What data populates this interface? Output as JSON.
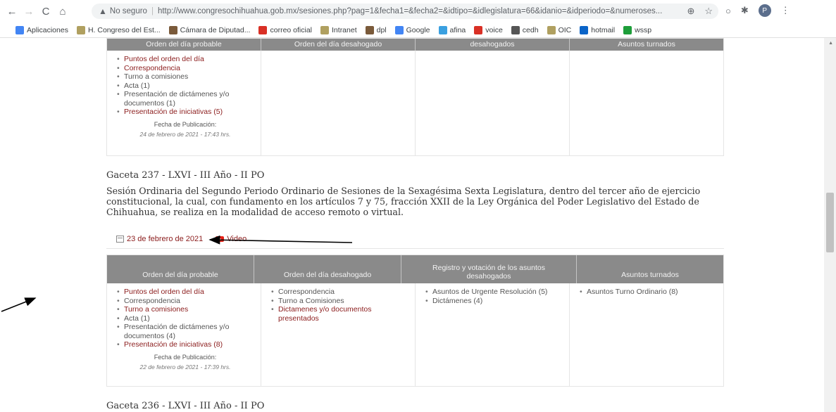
{
  "browser": {
    "not_secure": "No seguro",
    "url": "http://www.congresochihuahua.gob.mx/sesiones.php?pag=1&fecha1=&fecha2=&idtipo=&idlegislatura=66&idanio=&idperiodo=&numeroses...",
    "profile_initial": "P"
  },
  "bookmarks": [
    {
      "label": "Aplicaciones",
      "color": "#4285f4",
      "icon": "apps-grid-icon"
    },
    {
      "label": "H. Congreso del Est...",
      "color": "#b0a060",
      "icon": "congress-icon"
    },
    {
      "label": "Cámara de Diputad...",
      "color": "#7a5a3a",
      "icon": "camara-icon"
    },
    {
      "label": "correo oficial",
      "color": "#d93025",
      "icon": "x-icon"
    },
    {
      "label": "Intranet",
      "color": "#b0a060",
      "icon": "intranet-icon"
    },
    {
      "label": "dpl",
      "color": "#7a5a3a",
      "icon": "dpl-icon"
    },
    {
      "label": "Google",
      "color": "#4285f4",
      "icon": "google-icon"
    },
    {
      "label": "afina",
      "color": "#3aa0e0",
      "icon": "afina-icon"
    },
    {
      "label": "voice",
      "color": "#d93025",
      "icon": "voice-icon"
    },
    {
      "label": "cedh",
      "color": "#555555",
      "icon": "cedh-icon"
    },
    {
      "label": "OIC",
      "color": "#b0a060",
      "icon": "oic-icon"
    },
    {
      "label": "hotmail",
      "color": "#0a64c8",
      "icon": "outlook-icon"
    },
    {
      "label": "wssp",
      "color": "#1e9e3a",
      "icon": "wssp-icon"
    }
  ],
  "table_headers": [
    "Orden del día probable",
    "Orden del día desahogado",
    "Registro y votación de los asuntos desahogados",
    "Asuntos turnados"
  ],
  "table_headers_top": [
    "Orden del día probable",
    "Orden del día desahogado",
    "desahogados",
    "Asuntos turnados"
  ],
  "top_block": {
    "col1": [
      {
        "text": "Puntos del orden del día",
        "link": true
      },
      {
        "text": "Correspondencia",
        "link": true
      },
      {
        "text": "Turno a comisiones",
        "link": false
      },
      {
        "text": "Acta (1)",
        "link": false
      },
      {
        "text": "Presentación de dictámenes y/o documentos (1)",
        "link": false
      },
      {
        "text": "Presentación de iniciativas (5)",
        "link": true
      }
    ],
    "pub_label": "Fecha de Publicación:",
    "pub_date": "24 de febrero de 2021 - 17:43 hrs."
  },
  "gaceta237": {
    "title": "Gaceta 237 - LXVI - III Año - II PO",
    "description": "Sesión Ordinaria del Segundo Periodo Ordinario de Sesiones de la Sexagésima Sexta Legislatura, dentro del tercer año de ejercicio constitucional, la cual, con fundamento en los artículos 7 y 75, fracción XXII de la Ley Orgánica del Poder Legislativo del Estado de Chihuahua, se realiza en la modalidad de acceso remoto o virtual.",
    "date": "23 de febrero de 2021",
    "video": "Video",
    "col1": [
      {
        "text": "Puntos del orden del día",
        "link": true
      },
      {
        "text": "Correspondencia",
        "link": false
      },
      {
        "text": "Turno a comisiones",
        "link": true
      },
      {
        "text": "Acta (1)",
        "link": false
      },
      {
        "text": "Presentación de dictámenes y/o documentos (4)",
        "link": false
      },
      {
        "text": "Presentación de iniciativas (8)",
        "link": true
      }
    ],
    "col2": [
      {
        "text": "Correspondencia",
        "link": false
      },
      {
        "text": "Turno a Comisiones",
        "link": false
      },
      {
        "text": "Dictamenes y/o documentos presentados",
        "link": true
      }
    ],
    "col3": [
      {
        "text": "Asuntos de Urgente Resolución (5)",
        "link": false
      },
      {
        "text": "Dictámenes (4)",
        "link": false
      }
    ],
    "col4": [
      {
        "text": "Asuntos Turno Ordinario (8)",
        "link": false
      }
    ],
    "pub_label": "Fecha de Publicación:",
    "pub_date": "22 de febrero de 2021 - 17:39 hrs."
  },
  "gaceta236": {
    "title": "Gaceta 236 - LXVI - III Año - II PO"
  }
}
